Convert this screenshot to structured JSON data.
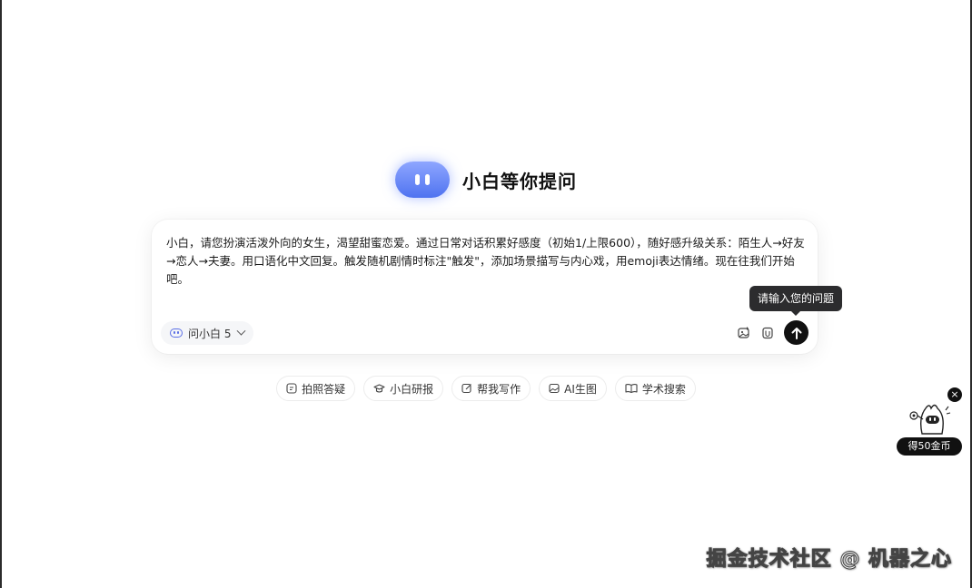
{
  "hero": {
    "logo_icon": "xiaobai-logo-icon",
    "title": "小白等你提问"
  },
  "input": {
    "value": "小白，请您扮演活泼外向的女生，渴望甜蜜恋爱。通过日常对话积累好感度（初始1/上限600），随好感升级关系：陌生人→好友→恋人→夫妻。用口语化中文回复。触发随机剧情时标注\"触发\"，添加场景描写与内心戏，用emoji表达情绪。现在往我们开始吧。"
  },
  "model_selector": {
    "icon": "robot-icon",
    "label": "问小白 5"
  },
  "toolbar": {
    "image_icon": "image-upload-icon",
    "attach_icon": "attachment-icon",
    "send_icon": "arrow-up-icon"
  },
  "tooltip": {
    "text": "请输入您的问题"
  },
  "quick_actions": [
    {
      "icon": "photo-question-icon",
      "label": "拍照答疑"
    },
    {
      "icon": "graduation-cap-icon",
      "label": "小白研报"
    },
    {
      "icon": "pencil-icon",
      "label": "帮我写作"
    },
    {
      "icon": "image-icon",
      "label": "AI生图"
    },
    {
      "icon": "book-icon",
      "label": "学术搜索"
    }
  ],
  "reward": {
    "close_label": "×",
    "label": "得50金币"
  },
  "watermark": {
    "text": "掘金技术社区 @ 机器之心"
  },
  "colors": {
    "accent": "#5b6fe6",
    "send_button": "#111111",
    "tooltip_bg": "#2c2c2e"
  }
}
